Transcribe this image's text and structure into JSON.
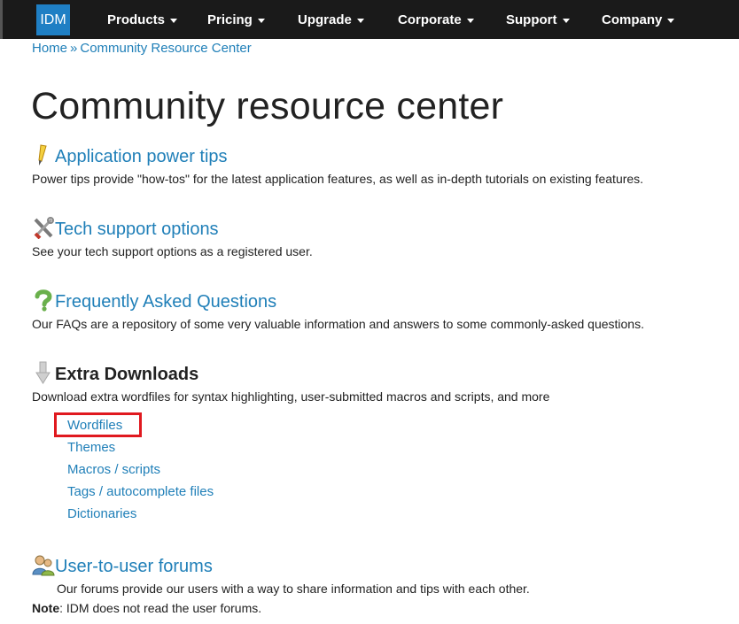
{
  "nav": {
    "logo": "IDM",
    "items": [
      {
        "label": "Products"
      },
      {
        "label": "Pricing"
      },
      {
        "label": "Upgrade"
      },
      {
        "label": "Corporate"
      },
      {
        "label": "Support"
      },
      {
        "label": "Company"
      }
    ]
  },
  "breadcrumb": {
    "home": "Home",
    "separator": "»",
    "current": "Community Resource Center"
  },
  "page_title": "Community resource center",
  "sections": {
    "power_tips": {
      "title": "Application power tips",
      "desc": "Power tips provide \"how-tos\" for the latest application features, as well as in-depth tutorials on existing features.",
      "icon": "pencil-icon"
    },
    "tech_support": {
      "title": "Tech support options",
      "desc": "See your tech support options as a registered user.",
      "icon": "tools-icon"
    },
    "faq": {
      "title": "Frequently Asked Questions",
      "desc": "Our FAQs are a repository of some very valuable information and answers to some commonly-asked questions.",
      "icon": "question-icon"
    },
    "downloads": {
      "title": "Extra Downloads",
      "desc": "Download extra wordfiles for syntax highlighting, user-submitted macros and scripts, and more",
      "icon": "download-arrow-icon",
      "links": [
        {
          "label": "Wordfiles"
        },
        {
          "label": "Themes"
        },
        {
          "label": "Macros / scripts"
        },
        {
          "label": "Tags / autocomplete files"
        },
        {
          "label": "Dictionaries"
        }
      ]
    },
    "forums": {
      "title": "User-to-user forums",
      "desc": "Our forums provide our users with a way to share information and tips with each other.",
      "icon": "users-icon",
      "note_label": "Note",
      "note_text": ": IDM does not read the user forums."
    }
  },
  "colors": {
    "nav_bg": "#1a1a1a",
    "link": "#1f7fb8",
    "logo_bg": "#1f7fc4",
    "highlight": "#e0191f"
  }
}
